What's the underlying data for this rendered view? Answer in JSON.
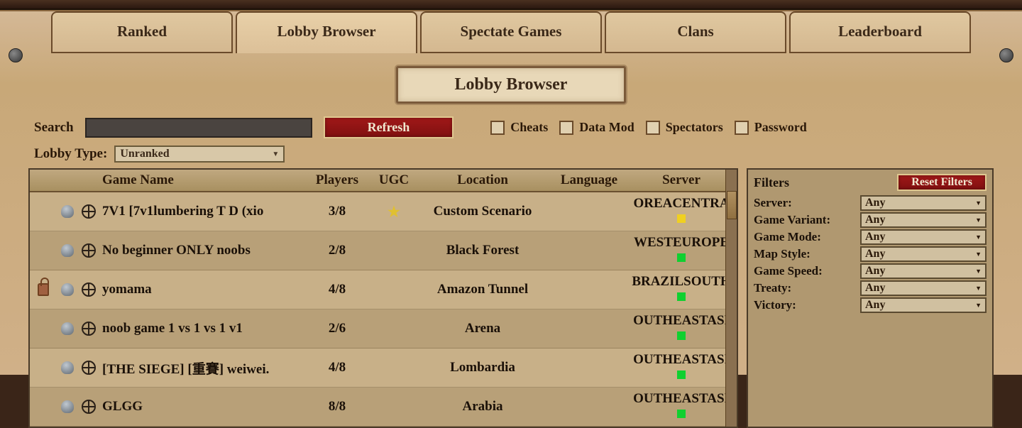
{
  "tabs": {
    "ranked": "Ranked",
    "lobby": "Lobby Browser",
    "spectate": "Spectate Games",
    "clans": "Clans",
    "leaderboard": "Leaderboard"
  },
  "title": "Lobby Browser",
  "search": {
    "label": "Search",
    "value": ""
  },
  "refresh_label": "Refresh",
  "checkboxes": {
    "cheats": "Cheats",
    "datamod": "Data Mod",
    "spectators": "Spectators",
    "password": "Password"
  },
  "lobby_type": {
    "label": "Lobby Type:",
    "selected": "Unranked"
  },
  "columns": {
    "name": "Game Name",
    "players": "Players",
    "ugc": "UGC",
    "location": "Location",
    "language": "Language",
    "server": "Server"
  },
  "rows": [
    {
      "locked": false,
      "name": "7V1 [7v1lumbering T D (xio",
      "players": "3/8",
      "ugc": true,
      "location": "Custom Scenario",
      "language": "",
      "server": "OREACENTRA",
      "ind": "y"
    },
    {
      "locked": false,
      "name": "No beginner ONLY noobs",
      "players": "2/8",
      "ugc": false,
      "location": "Black Forest",
      "language": "",
      "server": "WESTEUROPE",
      "ind": "g"
    },
    {
      "locked": true,
      "name": "yomama",
      "players": "4/8",
      "ugc": false,
      "location": "Amazon Tunnel",
      "language": "",
      "server": "BRAZILSOUTH",
      "ind": "g"
    },
    {
      "locked": false,
      "name": "noob game 1 vs 1 vs 1 v1",
      "players": "2/6",
      "ugc": false,
      "location": "Arena",
      "language": "",
      "server": "OUTHEASTASI",
      "ind": "g"
    },
    {
      "locked": false,
      "name": "[THE SIEGE] [重賽] weiwei.",
      "players": "4/8",
      "ugc": false,
      "location": "Lombardia",
      "language": "",
      "server": "OUTHEASTASI",
      "ind": "g"
    },
    {
      "locked": false,
      "name": "GLGG",
      "players": "8/8",
      "ugc": false,
      "location": "Arabia",
      "language": "",
      "server": "OUTHEASTASI",
      "ind": "g"
    }
  ],
  "filters": {
    "title": "Filters",
    "reset": "Reset Filters",
    "items": [
      {
        "label": "Server:",
        "value": "Any"
      },
      {
        "label": "Game Variant:",
        "value": "Any"
      },
      {
        "label": "Game Mode:",
        "value": "Any"
      },
      {
        "label": "Map Style:",
        "value": "Any"
      },
      {
        "label": "Game Speed:",
        "value": "Any"
      },
      {
        "label": "Treaty:",
        "value": "Any"
      },
      {
        "label": "Victory:",
        "value": "Any"
      }
    ]
  }
}
